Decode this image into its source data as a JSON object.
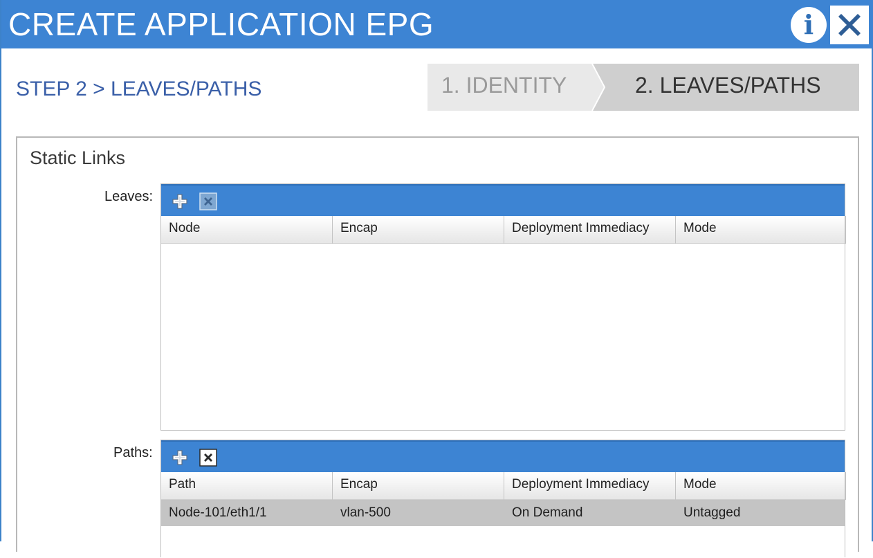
{
  "dialog": {
    "title": "CREATE APPLICATION EPG",
    "info_label": "i"
  },
  "step_heading": "STEP 2 > LEAVES/PATHS",
  "wizard": {
    "steps": [
      {
        "label": "1. IDENTITY",
        "state": "inactive"
      },
      {
        "label": "2. LEAVES/PATHS",
        "state": "active"
      }
    ]
  },
  "static_links": {
    "title": "Static Links",
    "leaves": {
      "label": "Leaves:",
      "columns": [
        "Node",
        "Encap",
        "Deployment Immediacy",
        "Mode"
      ],
      "rows": []
    },
    "paths": {
      "label": "Paths:",
      "columns": [
        "Path",
        "Encap",
        "Deployment Immediacy",
        "Mode"
      ],
      "rows": [
        {
          "path": "Node-101/eth1/1",
          "encap": "vlan-500",
          "deployment": "On Demand",
          "mode": "Untagged"
        }
      ]
    }
  },
  "colors": {
    "header_blue": "#3d84d3",
    "heading_blue": "#3a5fa8",
    "selected_row": "#c4c4c4"
  },
  "icons": [
    "info-icon",
    "close-icon",
    "add-icon",
    "delete-icon"
  ]
}
